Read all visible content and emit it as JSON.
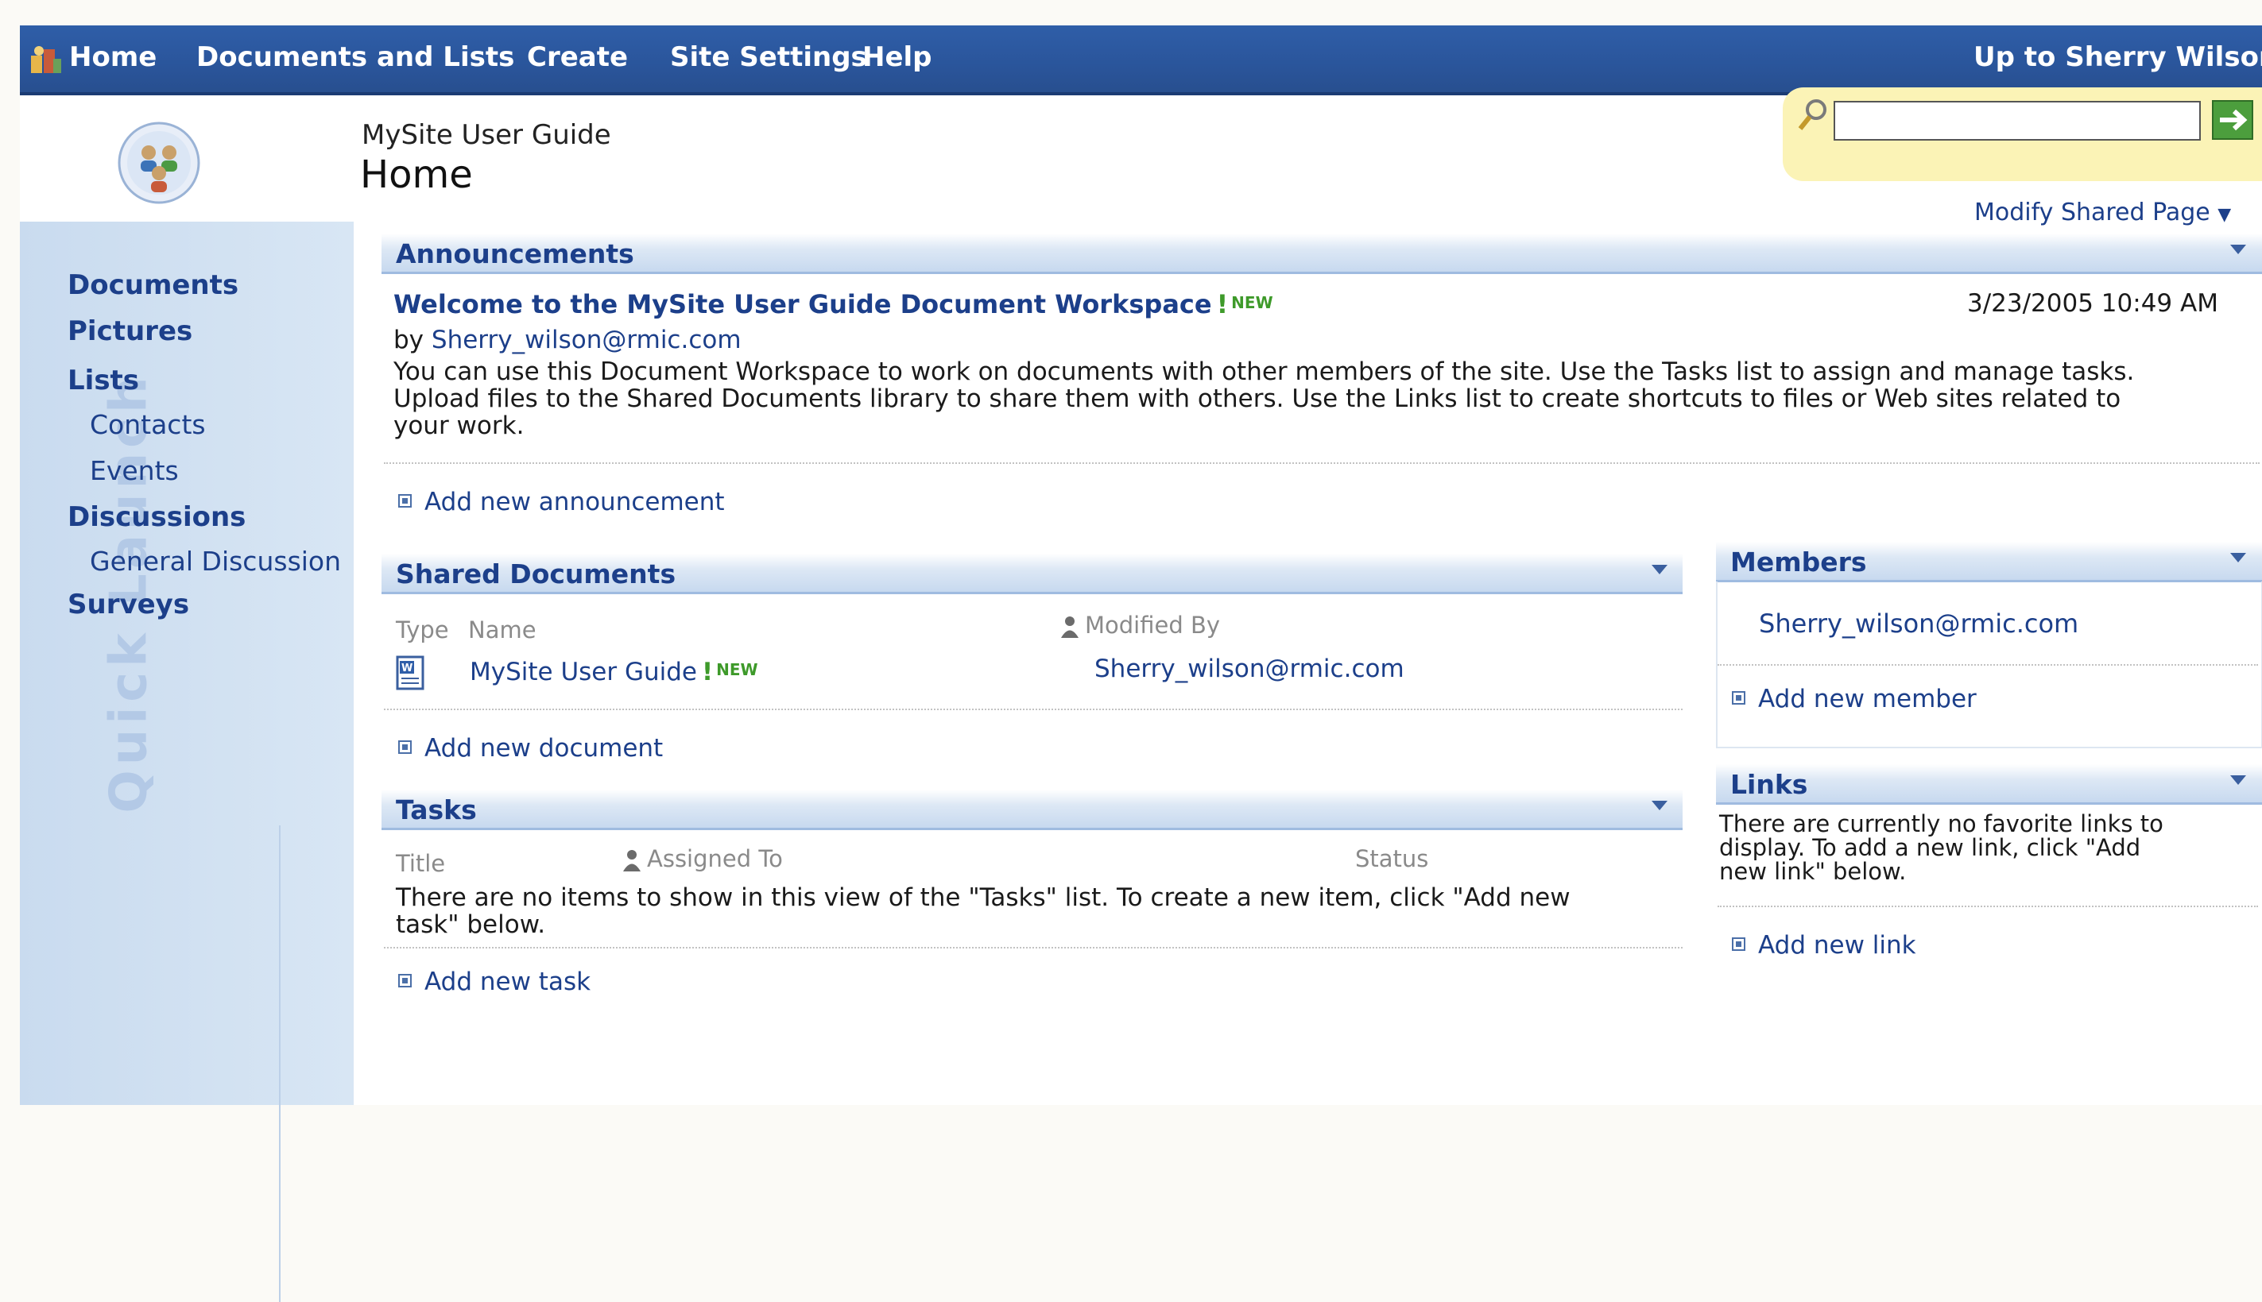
{
  "topnav": {
    "home": "Home",
    "documents_and_lists": "Documents and Lists",
    "create": "Create",
    "site_settings": "Site Settings",
    "help": "Help",
    "up_to": "Up to Sherry Wilson"
  },
  "header": {
    "site_name": "MySite User Guide",
    "page_title": "Home",
    "search_value": "",
    "modify_shared_page": "Modify Shared Page"
  },
  "quick_launch": {
    "watermark": "Quick Launch",
    "documents": "Documents",
    "pictures": "Pictures",
    "lists": "Lists",
    "contacts": "Contacts",
    "events": "Events",
    "discussions": "Discussions",
    "general_discussion": "General Discussion",
    "surveys": "Surveys"
  },
  "announcements": {
    "title": "Announcements",
    "item_title": "Welcome to the MySite User Guide Document Workspace",
    "new_tag": "NEW",
    "date": "3/23/2005 10:49 AM",
    "by": "by",
    "author": "Sherry_wilson@rmic.com",
    "body_line1": "You can use this Document Workspace to work on documents with other members of the site. Use the Tasks list to assign and manage tasks.",
    "body_line2": "Upload files to the Shared Documents library to share them with others. Use the Links list to create shortcuts to files or Web sites related to",
    "body_line3": "your work.",
    "add": "Add new announcement"
  },
  "shared_documents": {
    "title": "Shared Documents",
    "col_type": "Type",
    "col_name": "Name",
    "col_modified_by": "Modified By",
    "rows": [
      {
        "name": "MySite User Guide",
        "new_tag": "NEW",
        "modified_by": "Sherry_wilson@rmic.com"
      }
    ],
    "add": "Add new document"
  },
  "tasks": {
    "title": "Tasks",
    "col_title": "Title",
    "col_assigned_to": "Assigned To",
    "col_status": "Status",
    "empty_line1": "There are no items to show in this view of the \"Tasks\" list. To create a new item, click \"Add new",
    "empty_line2": "task\" below.",
    "add": "Add new task"
  },
  "members": {
    "title": "Members",
    "items": [
      "Sherry_wilson@rmic.com"
    ],
    "add": "Add new member"
  },
  "links": {
    "title": "Links",
    "empty_line1": "There are currently no favorite links to",
    "empty_line2": "display. To add a new link, click \"Add",
    "empty_line3": "new link\" below.",
    "add": "Add new link"
  },
  "colors": {
    "nav_bar": "#2a559b",
    "link": "#1c3f8a",
    "quick_launch_bg": "#d3e2f2",
    "search_bg": "#fbf3b6",
    "new_tag": "#3e9a2a"
  }
}
